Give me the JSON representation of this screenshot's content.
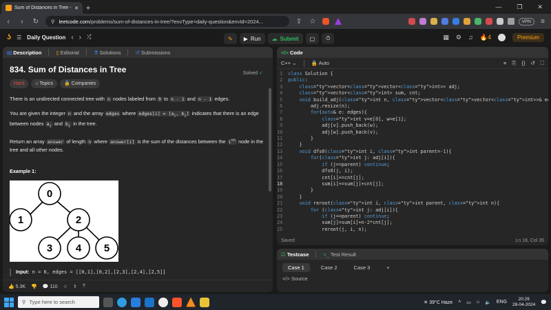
{
  "browser": {
    "tab_title": "Sum of Distances in Tree - Leet",
    "new_tab": "+",
    "url_domain": "leetcode.com",
    "url_path": "/problems/sum-of-distances-in-tree/?envType=daily-question&envId=2024...",
    "vpn": "VPN"
  },
  "nav": {
    "problem_list": "Daily Question",
    "run": "Run",
    "submit": "Submit",
    "streak": "4",
    "premium": "Premium"
  },
  "left_tabs": {
    "description": "Description",
    "editorial": "Editorial",
    "solutions": "Solutions",
    "submissions": "Submissions"
  },
  "problem": {
    "title": "834. Sum of Distances in Tree",
    "status": "Solved",
    "difficulty": "Hard",
    "topics": "Topics",
    "companies": "Companies",
    "p1": {
      "a": "There is an undirected connected tree with ",
      "b": "n",
      "c": " nodes labeled from ",
      "d": "0",
      "e": " to ",
      "f": "n - 1",
      "g": " and ",
      "h": "n - 1",
      "i": " edges."
    },
    "p2": {
      "a": "You are given the integer ",
      "b": "n",
      "c": " and the array ",
      "d": "edges",
      "e": " where ",
      "f": "edges[i] = [a",
      "g": "i",
      "h": ", b",
      "i": "i",
      "j": "]",
      "k": " indicates that there is an edge between nodes ",
      "l": "a",
      "m": "i",
      "n": " and ",
      "o": "b",
      "p": "i",
      "q": " in the tree."
    },
    "p3": {
      "a": "Return an array ",
      "b": "answer",
      "c": " of length ",
      "d": "n",
      "e": " where ",
      "f": "answer[i]",
      "g": " is the sum of the distances between the ",
      "h": "i",
      "i": "th",
      "j": " node in the tree and all other nodes."
    },
    "example_heading": "Example 1:",
    "tree_nodes": [
      "0",
      "1",
      "2",
      "3",
      "4",
      "5"
    ],
    "input_label": "Input:",
    "input_value": "n = 6, edges = [[0,1],[0,2],[2,3],[2,4],[2,5]]",
    "likes": "5.3K",
    "comments": "110"
  },
  "code_panel": {
    "title": "Code",
    "language": "C++",
    "autosave": "Auto",
    "saved": "Saved",
    "position": "Ln 18, Col 35",
    "line_numbers": [
      "1",
      "2",
      "3",
      "4",
      "5",
      "6",
      "7",
      "8",
      "9",
      "10",
      "11",
      "12",
      "13",
      "14",
      "15",
      "16",
      "17",
      "18",
      "19",
      "20",
      "21",
      "22",
      "23",
      "24",
      "25"
    ],
    "lines": [
      "class Solution {",
      "public:",
      "    vector<vector<int>> adj;",
      "    vector<int> sum, cnt;",
      "    void build_adj(int n, vector<vector<int>>& edges){",
      "        adj.resize(n);",
      "        for(auto& e: edges){",
      "            int v=e[0], w=e[1];",
      "            adj[v].push_back(w);",
      "            adj[w].push_back(v);",
      "        }",
      "    }",
      "    void dfs0(int i, int parent=-1){",
      "        for(int j: adj[i]){",
      "            if (j==parent) continue;",
      "            dfs0(j, i);",
      "            cnt[i]+=cnt[j];",
      "            sum[i]+=sum[j]+cnt[j];",
      "        }",
      "    }",
      "    void reroot(int i, int parent, int n){",
      "        for (int j: adj[i]){",
      "            if (j==parent) continue;",
      "            sum[j]=sum[i]+n-2*cnt[j];",
      "            reroot(j, i, n);"
    ]
  },
  "test_panel": {
    "testcase": "Testcase",
    "result": "Test Result",
    "cases": [
      "Case 1",
      "Case 2",
      "Case 3"
    ],
    "add": "+",
    "source": "Source"
  },
  "taskbar": {
    "search_placeholder": "Type here to search",
    "weather": "39°C  Haze",
    "lang": "ENG",
    "time": "20:29",
    "date": "28-04-2024"
  }
}
